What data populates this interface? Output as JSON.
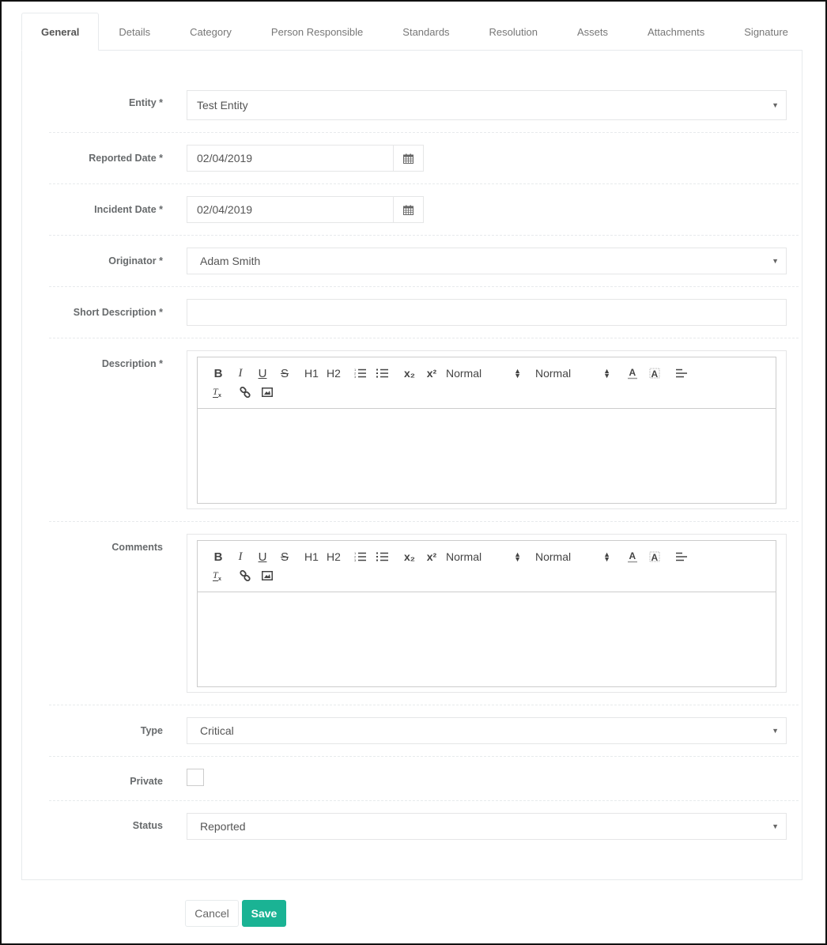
{
  "tabs": [
    {
      "label": "General",
      "active": true
    },
    {
      "label": "Details"
    },
    {
      "label": "Category"
    },
    {
      "label": "Person Responsible"
    },
    {
      "label": "Standards"
    },
    {
      "label": "Resolution"
    },
    {
      "label": "Assets"
    },
    {
      "label": "Attachments"
    },
    {
      "label": "Signature"
    }
  ],
  "form": {
    "entity": {
      "label": "Entity *",
      "value": "Test Entity",
      "icon": "caret-down-icon"
    },
    "reported_date": {
      "label": "Reported Date *",
      "value": "02/04/2019",
      "icon": "calendar-icon"
    },
    "incident_date": {
      "label": "Incident Date *",
      "value": "02/04/2019",
      "icon": "calendar-icon"
    },
    "originator": {
      "label": "Originator *",
      "value": "Adam Smith",
      "icon": "caret-down-icon"
    },
    "short_description": {
      "label": "Short Description *",
      "value": ""
    },
    "description": {
      "label": "Description *",
      "value": ""
    },
    "comments": {
      "label": "Comments",
      "value": ""
    },
    "type": {
      "label": "Type",
      "value": "Critical",
      "icon": "caret-down-icon"
    },
    "private": {
      "label": "Private",
      "checked": false
    },
    "status": {
      "label": "Status",
      "value": "Reported",
      "icon": "caret-down-icon"
    }
  },
  "editor_toolbar": {
    "bold": "B",
    "italic": "I",
    "underline": "U",
    "strike": "S",
    "h1": "H1",
    "h2": "H2",
    "subscript": "x₂",
    "superscript": "x²",
    "size_picker": "Normal",
    "header_picker": "Normal"
  },
  "actions": {
    "cancel": "Cancel",
    "save": "Save"
  },
  "colors": {
    "accent": "#1ab394",
    "border": "#e7eaec",
    "label": "#676a6c"
  },
  "caret": "▼"
}
